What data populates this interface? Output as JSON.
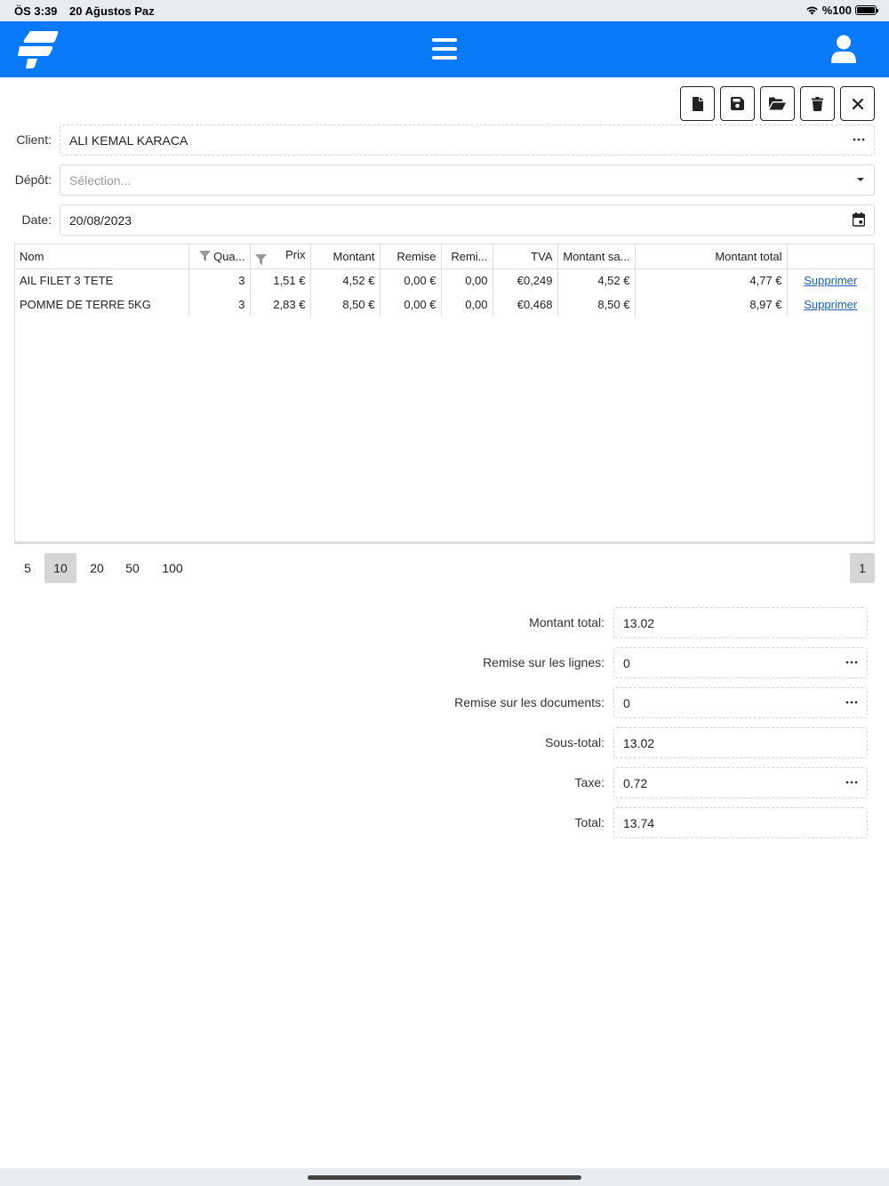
{
  "status_bar": {
    "time": "ÖS 3:39",
    "date": "20 Ağustos Paz",
    "battery": "%100",
    "battery_level": 1.0
  },
  "colors": {
    "header": "#0a79f7",
    "link": "#1a5fb4"
  },
  "header": {
    "logo_icon": "brand-logo-icon",
    "menu_icon": "hamburger-menu-icon",
    "user_icon": "user-icon"
  },
  "toolbar": {
    "buttons": [
      {
        "name": "new-document-button",
        "icon": "file-icon"
      },
      {
        "name": "save-button",
        "icon": "save-icon"
      },
      {
        "name": "open-button",
        "icon": "folder-open-icon"
      },
      {
        "name": "delete-button",
        "icon": "trash-icon"
      },
      {
        "name": "close-button",
        "icon": "close-icon"
      }
    ]
  },
  "form": {
    "client_label": "Client:",
    "client_value": "ALI KEMAL KARACA",
    "depot_label": "Dépôt:",
    "depot_placeholder": "Sélection...",
    "date_label": "Date:",
    "date_value": "20/08/2023"
  },
  "grid": {
    "columns": [
      "Nom",
      "Qua...",
      "Prix",
      "Montant",
      "Remise",
      "Remi...",
      "TVA",
      "Montant sa...",
      "Montant total",
      ""
    ],
    "rows": [
      {
        "nom": "AIL FILET 3 TETE",
        "quantite": "3",
        "prix": "1,51 €",
        "montant": "4,52 €",
        "remise": "0,00 €",
        "remise_pct": "0,00",
        "tva": "€0,249",
        "montant_sans_taxe": "4,52 €",
        "montant_total": "4,77 €",
        "action": "Supprimer"
      },
      {
        "nom": "POMME DE TERRE 5KG",
        "quantite": "3",
        "prix": "2,83 €",
        "montant": "8,50 €",
        "remise": "0,00 €",
        "remise_pct": "0,00",
        "tva": "€0,468",
        "montant_sans_taxe": "8,50 €",
        "montant_total": "8,97 €",
        "action": "Supprimer"
      }
    ]
  },
  "pager": {
    "page_sizes": [
      "5",
      "10",
      "20",
      "50",
      "100"
    ],
    "selected_page_size": "10",
    "current_page": "1"
  },
  "summary": {
    "montant_total_label": "Montant total:",
    "montant_total_value": "13.02",
    "remise_lignes_label": "Remise sur les lignes:",
    "remise_lignes_value": "0",
    "remise_documents_label": "Remise sur les documents:",
    "remise_documents_value": "0",
    "sous_total_label": "Sous-total:",
    "sous_total_value": "13.02",
    "taxe_label": "Taxe:",
    "taxe_value": "0.72",
    "total_label": "Total:",
    "total_value": "13.74"
  }
}
